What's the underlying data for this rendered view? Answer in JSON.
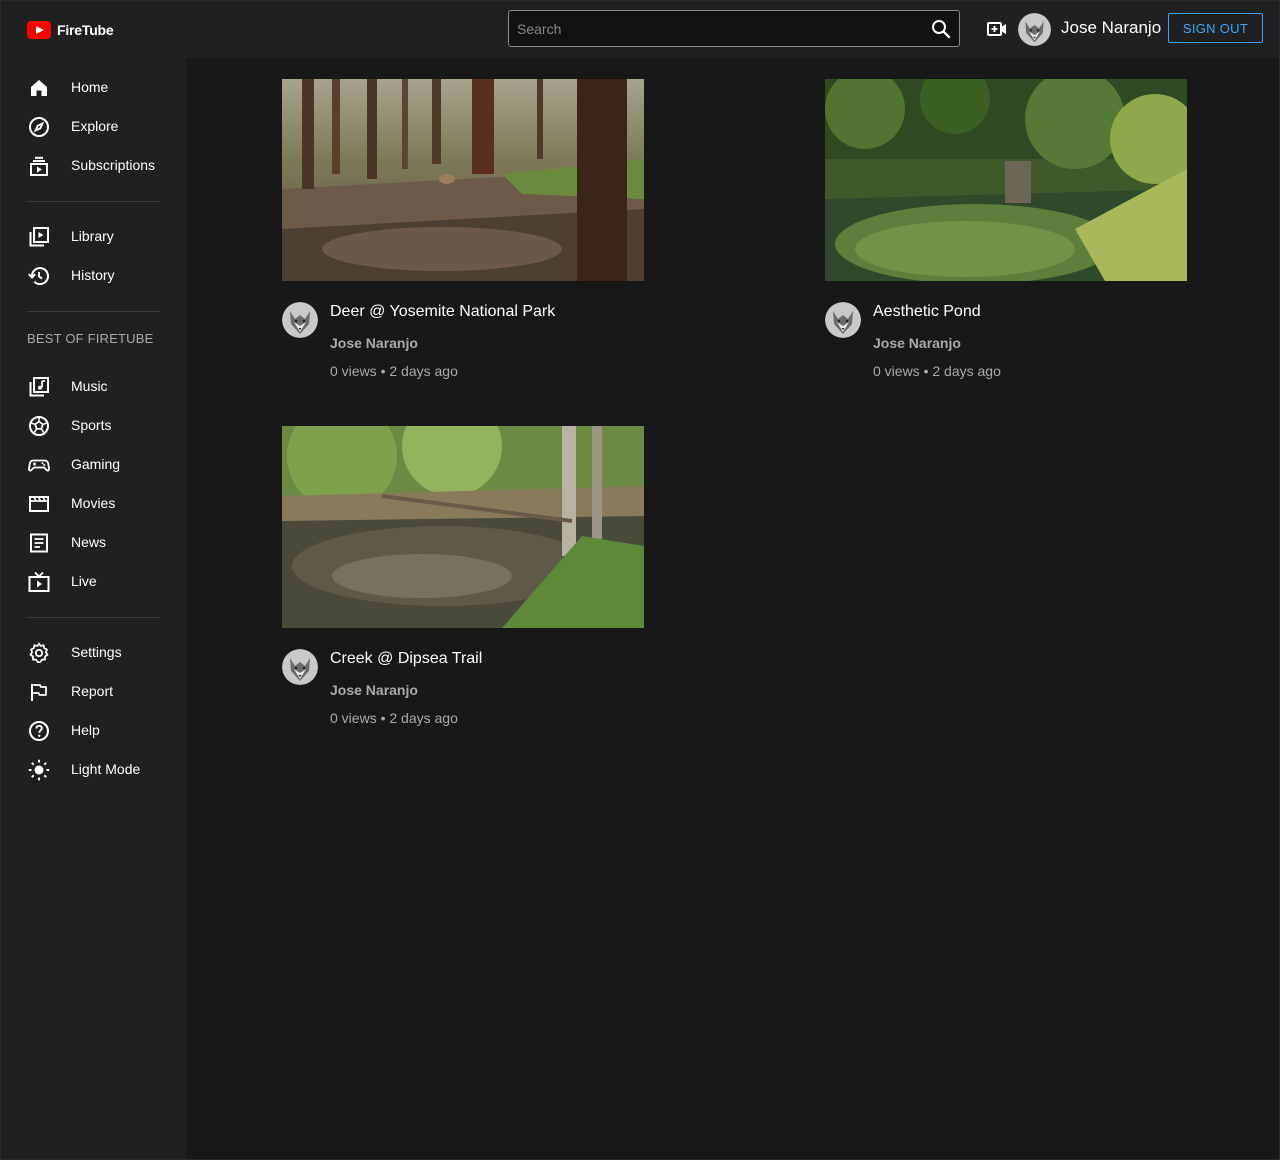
{
  "app": {
    "name": "FireTube"
  },
  "header": {
    "search_placeholder": "Search",
    "user_name": "Jose Naranjo",
    "signout_label": "SIGN OUT"
  },
  "sidebar": {
    "primary": [
      {
        "label": "Home",
        "icon": "home-icon"
      },
      {
        "label": "Explore",
        "icon": "compass-icon"
      },
      {
        "label": "Subscriptions",
        "icon": "subscriptions-icon"
      }
    ],
    "library": [
      {
        "label": "Library",
        "icon": "library-icon"
      },
      {
        "label": "History",
        "icon": "history-icon"
      }
    ],
    "best_of_title": "BEST OF FIRETUBE",
    "best_of": [
      {
        "label": "Music",
        "icon": "music-icon"
      },
      {
        "label": "Sports",
        "icon": "sports-icon"
      },
      {
        "label": "Gaming",
        "icon": "gamepad-icon"
      },
      {
        "label": "Movies",
        "icon": "movies-icon"
      },
      {
        "label": "News",
        "icon": "news-icon"
      },
      {
        "label": "Live",
        "icon": "live-icon"
      }
    ],
    "footer": [
      {
        "label": "Settings",
        "icon": "gear-icon"
      },
      {
        "label": "Report",
        "icon": "flag-icon"
      },
      {
        "label": "Help",
        "icon": "help-icon"
      },
      {
        "label": "Light Mode",
        "icon": "sun-icon"
      }
    ]
  },
  "videos": [
    {
      "title": "Deer @ Yosemite National Park",
      "channel": "Jose Naranjo",
      "meta": "0 views • 2 days ago"
    },
    {
      "title": "Aesthetic Pond",
      "channel": "Jose Naranjo",
      "meta": "0 views • 2 days ago"
    },
    {
      "title": "Creek @ Dipsea Trail",
      "channel": "Jose Naranjo",
      "meta": "0 views • 2 days ago"
    }
  ]
}
